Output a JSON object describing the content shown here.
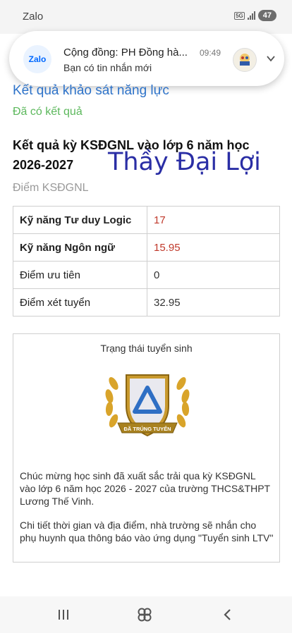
{
  "status_bar": {
    "app_name": "Zalo",
    "network": "5G",
    "battery": "47"
  },
  "notification": {
    "logo_text": "Zalo",
    "title": "Cộng đồng: PH Đồng hà...",
    "time": "09:49",
    "message": "Bạn có tin nhắn mới",
    "brand_color": "#0068ff"
  },
  "page": {
    "section_title": "Kết quả khảo sát năng lực",
    "result_status": "Đã có kết quả",
    "heading": "Kết quả kỳ KSĐGNL vào lớp 6 năm học 2026-2027",
    "watermark": "Thầy Đại Lợi",
    "scores_label": "Điểm KSĐGNL",
    "scores": [
      {
        "label": "Kỹ năng Tư duy Logic",
        "value": "17"
      },
      {
        "label": "Kỹ năng Ngôn ngữ",
        "value": "15.95"
      },
      {
        "label": "Điểm ưu tiên",
        "value": "0"
      },
      {
        "label": "Điểm xét tuyển",
        "value": "32.95"
      }
    ],
    "admission": {
      "title": "Trạng thái tuyển sinh",
      "badge_text": "ĐÃ TRÚNG TUYỂN",
      "message1": "Chúc mừng học sinh đã xuất sắc trải qua kỳ KSĐGNL vào lớp 6 năm học 2026 - 2027 của trường THCS&THPT Lương Thế Vinh.",
      "message2": "Chi tiết thời gian và địa điểm, nhà trường sẽ nhắn cho phụ huynh qua thông báo vào ứng dụng \"Tuyển sinh LTV\""
    }
  },
  "nav": {
    "recents_icon": "recent-apps-icon",
    "home_icon": "home-icon",
    "back_icon": "back-icon"
  },
  "colors": {
    "link_blue": "#2e73c9",
    "success_green": "#5cb85c",
    "score_red": "#c0392b",
    "watermark": "#2a2ea5"
  }
}
